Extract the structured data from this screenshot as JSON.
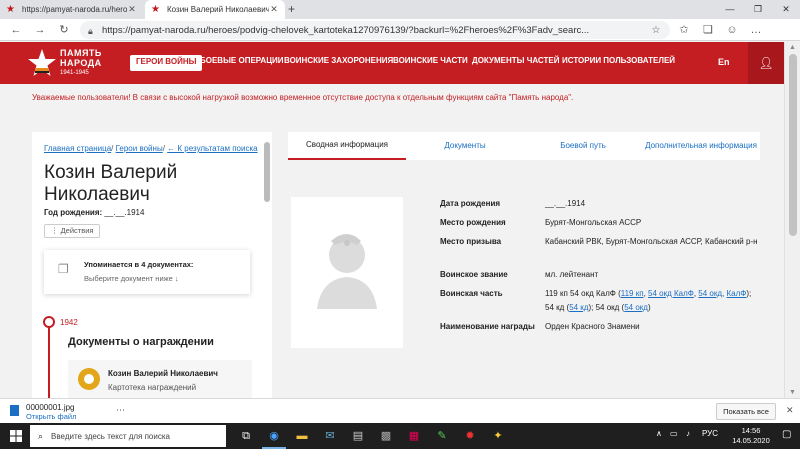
{
  "browser": {
    "tabs": [
      {
        "title": "https://pamyat-naroda.ru/heroes",
        "active": false
      },
      {
        "title": "Козин Валерий Николаевич с П",
        "active": true
      }
    ],
    "url": "https://pamyat-naroda.ru/heroes/podvig-chelovek_kartoteka1270976139/?backurl=%2Fheroes%2F%3Fadv_searc..."
  },
  "site": {
    "logo_line1": "ПАМЯТЬ",
    "logo_line2": "НАРОДА",
    "logo_years": "1941-1945",
    "nav": [
      {
        "label": "ГЕРОИ ВОЙНЫ",
        "active": true
      },
      {
        "label": "БОЕВЫЕ ОПЕРАЦИИ",
        "active": false
      },
      {
        "label": "ВОИНСКИЕ ЗАХОРОНЕНИЯ",
        "active": false
      },
      {
        "label": "ВОИНСКИЕ ЧАСТИ",
        "active": false
      },
      {
        "label": "ДОКУМЕНТЫ ЧАСТЕЙ",
        "active": false
      },
      {
        "label": "ИСТОРИИ ПОЛЬЗОВАТЕЛЕЙ",
        "active": false
      }
    ],
    "lang": "En",
    "notice": "Уважаемые пользователи! В связи с высокой нагрузкой возможно временное отсутствие доступа к отдельным функциям сайта \"Память народа\"."
  },
  "left": {
    "crumb_home": "Главная страница",
    "crumb_heroes": "Герои войны",
    "crumb_back": "← К результатам поиска",
    "name": "Козин Валерий Николаевич",
    "birth_label": "Год рождения:",
    "birth_value": "__.__.1914",
    "actions": "⋮ Действия",
    "mentions_title": "Упоминается в 4 документах:",
    "mentions_sub": "Выберите документ ниже ↓",
    "year": "1942",
    "awards_heading": "Документы о награждении",
    "award_name": "Козин Валерий Николаевич",
    "award_sub": "Картотека награждений"
  },
  "right": {
    "tabs": [
      {
        "label": "Сводная информация",
        "active": true
      },
      {
        "label": "Документы",
        "active": false
      },
      {
        "label": "Боевой путь",
        "active": false
      },
      {
        "label": "Дополнительная информация",
        "active": false
      }
    ],
    "fields": {
      "birth_date": {
        "label": "Дата рождения",
        "value": "__.__.1914"
      },
      "birth_place": {
        "label": "Место рождения",
        "value": "Бурят-Монгольская АССР"
      },
      "draft_place": {
        "label": "Место призыва",
        "value": "Кабанский РВК, Бурят-Монгольская АССР, Кабанский р-н"
      },
      "rank": {
        "label": "Воинское звание",
        "value": "мл. лейтенант"
      },
      "unit": {
        "label": "Воинская часть",
        "t1": "119 кп 54 окд КалФ (",
        "l1": "119 кп",
        "t2": ", ",
        "l2": "54 окд КалФ",
        "t3": ", ",
        "l3": "54 окд",
        "t4": ", ",
        "l4": "КалФ",
        "t5": "); 54 кд (",
        "l5": "54 кд",
        "t6": "); 54 окд (",
        "l6": "54 окд",
        "t7": ")"
      },
      "award": {
        "label": "Наименование награды",
        "value": "Орден Красного Знамени"
      }
    }
  },
  "download": {
    "filename": "00000001.jpg",
    "open_label": "Открыть файл",
    "show_all": "Показать все"
  },
  "taskbar": {
    "search_placeholder": "Введите здесь текст для поиска",
    "lang": "РУС",
    "time": "14:56",
    "date": "14.05.2020"
  }
}
